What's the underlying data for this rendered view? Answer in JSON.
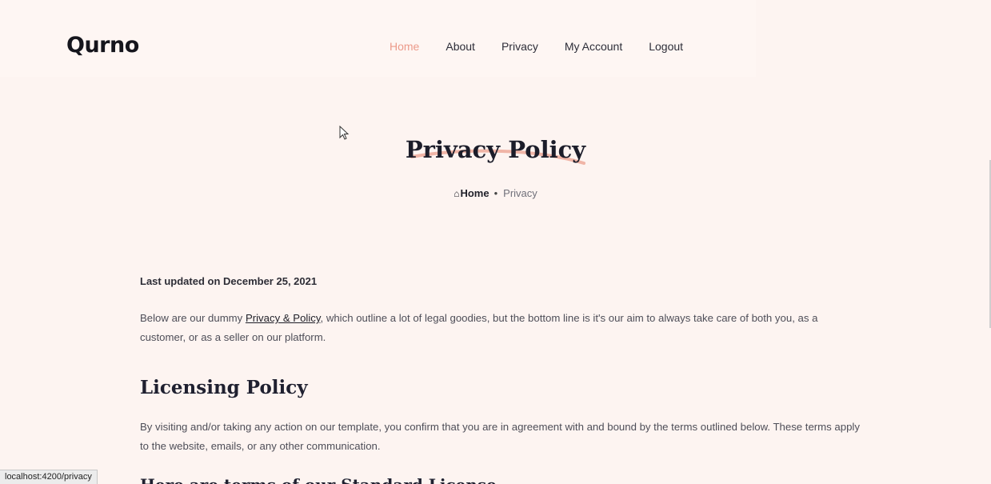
{
  "brand": {
    "logo_text": "Qurno"
  },
  "nav": {
    "items": [
      {
        "label": "Home",
        "active": true
      },
      {
        "label": "About",
        "active": false
      },
      {
        "label": "Privacy",
        "active": false
      },
      {
        "label": "My Account",
        "active": false
      },
      {
        "label": "Logout",
        "active": false
      }
    ]
  },
  "hero": {
    "title": "Privacy Policy",
    "breadcrumb": {
      "home": "Home",
      "separator": "•",
      "current": "Privacy"
    }
  },
  "content": {
    "updated": "Last updated on December 25, 2021",
    "intro_before_link": "Below are our dummy ",
    "intro_link": "Privacy & Policy",
    "intro_after_link": ", which outline a lot of legal goodies, but the bottom line is it's our aim to always take care of both you, as a customer, or as a seller on our platform.",
    "section_title": "Licensing Policy",
    "section_body": "By visiting and/or taking any action on our template, you confirm that you are in agreement with and bound by the terms outlined below. These terms apply to the website, emails, or any other communication.",
    "next_heading_partial": "Here are terms of our Standard License"
  },
  "status_bar": {
    "url": "localhost:4200/privacy"
  },
  "colors": {
    "accent": "#ec9a8a",
    "background": "#fdf4f1",
    "heading": "#1f2030"
  }
}
